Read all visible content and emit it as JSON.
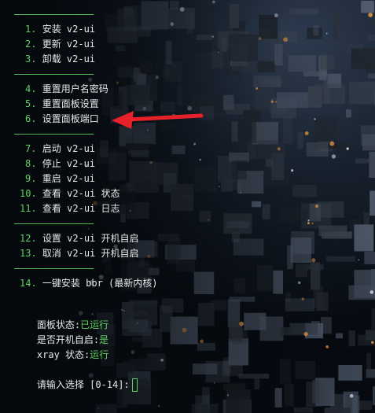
{
  "menu": {
    "separator": "——————————————",
    "groups": [
      [
        {
          "num": "1.",
          "label": "安装 v2-ui"
        },
        {
          "num": "2.",
          "label": "更新 v2-ui"
        },
        {
          "num": "3.",
          "label": "卸载 v2-ui"
        }
      ],
      [
        {
          "num": "4.",
          "label": "重置用户名密码"
        },
        {
          "num": "5.",
          "label": "重置面板设置"
        },
        {
          "num": "6.",
          "label": "设置面板端口"
        }
      ],
      [
        {
          "num": "7.",
          "label": "启动 v2-ui"
        },
        {
          "num": "8.",
          "label": "停止 v2-ui"
        },
        {
          "num": "9.",
          "label": "重启 v2-ui"
        },
        {
          "num": "10.",
          "label": "查看 v2-ui 状态"
        },
        {
          "num": "11.",
          "label": "查看 v2-ui 日志"
        }
      ],
      [
        {
          "num": "12.",
          "label": "设置 v2-ui 开机自启"
        },
        {
          "num": "13.",
          "label": "取消 v2-ui 开机自启"
        }
      ],
      [
        {
          "num": "14.",
          "label": "一键安装 bbr (最新内核)"
        }
      ]
    ]
  },
  "status": {
    "panel_label": "面板状态:",
    "panel_value": "已运行",
    "autostart_label": "是否开机自启:",
    "autostart_value": "是",
    "xray_label": "xray 状态:",
    "xray_value": "运行"
  },
  "prompt": {
    "label": "请输入选择 [0-14]:"
  },
  "colors": {
    "accent_green": "#5fd35f",
    "arrow_red": "#e8202a",
    "text": "#e8e8e8"
  },
  "annotation": {
    "arrow_icon": "red-arrow-left",
    "points_to": "6."
  }
}
